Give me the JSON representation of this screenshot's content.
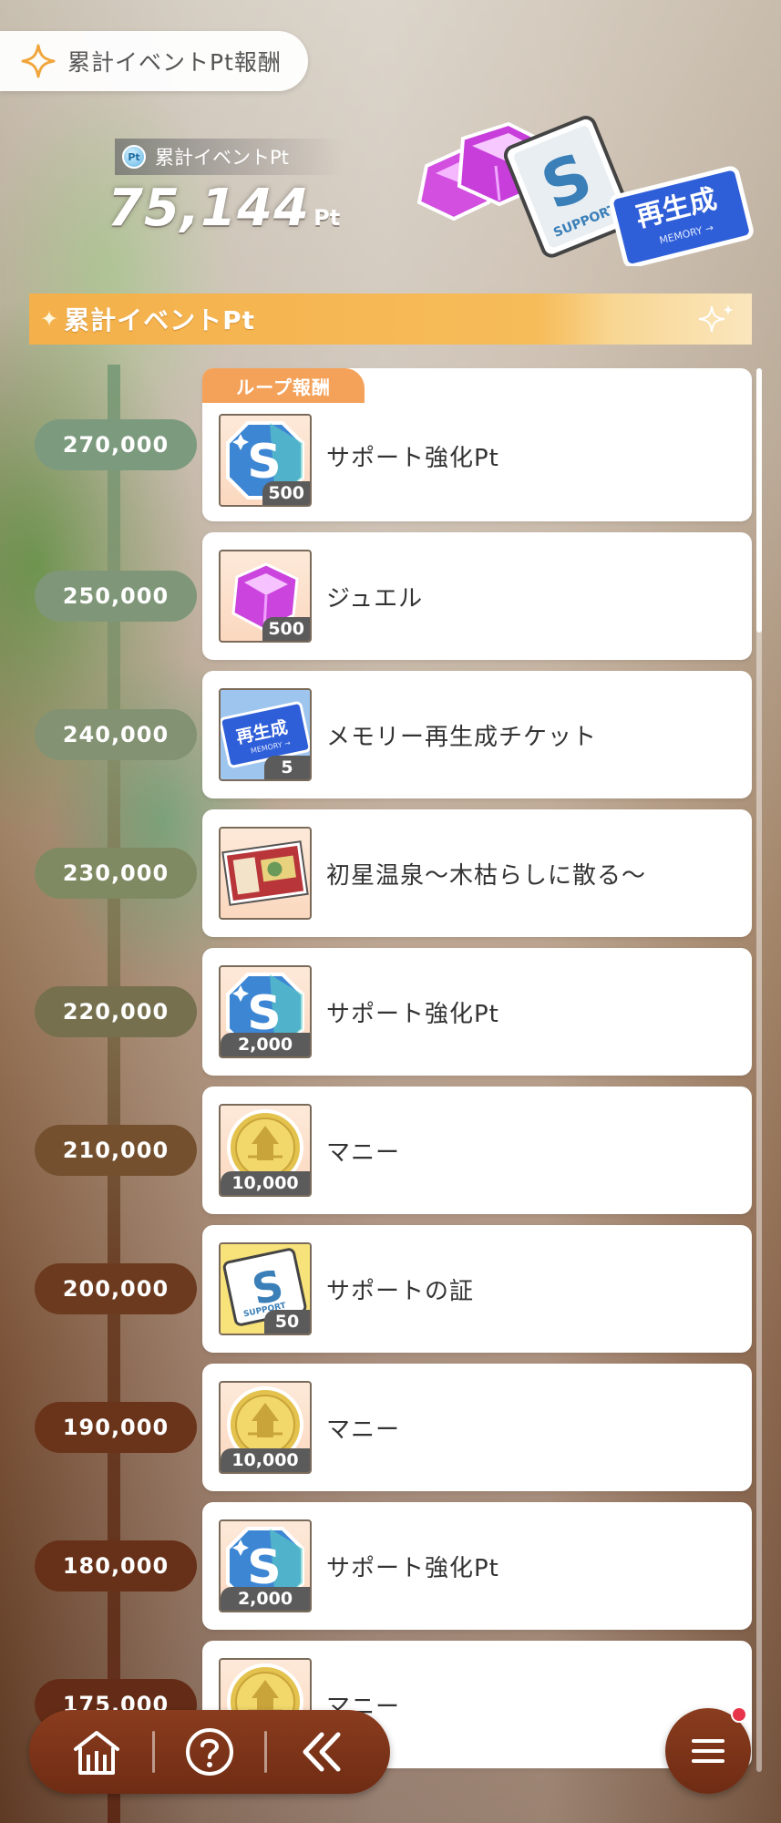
{
  "header": {
    "title": "累計イベントPt報酬",
    "points_label": "累計イベントPt",
    "points_badge": "Pt",
    "points_value": "75,144",
    "points_unit": "Pt"
  },
  "section": {
    "title": "累計イベントPt"
  },
  "loop_tag": "ループ報酬",
  "milestones": [
    {
      "threshold": "270,000",
      "color": "#7c9a7e",
      "item": "サポート強化Pt",
      "qty": "500",
      "icon": "support-pt-icon"
    },
    {
      "threshold": "250,000",
      "color": "#7f9778",
      "item": "ジュエル",
      "qty": "500",
      "icon": "jewel-icon"
    },
    {
      "threshold": "240,000",
      "color": "#829272",
      "item": "メモリー再生成チケット",
      "qty": "5",
      "icon": "memory-ticket-icon"
    },
    {
      "threshold": "230,000",
      "color": "#7f8a62",
      "item": "初星温泉～木枯らしに散る～",
      "qty": "",
      "icon": "memory-card-icon"
    },
    {
      "threshold": "220,000",
      "color": "#76704e",
      "item": "サポート強化Pt",
      "qty": "2,000",
      "icon": "support-pt-icon"
    },
    {
      "threshold": "210,000",
      "color": "#74502f",
      "item": "マニー",
      "qty": "10,000",
      "icon": "money-coin-icon"
    },
    {
      "threshold": "200,000",
      "color": "#6c3a1e",
      "item": "サポートの証",
      "qty": "50",
      "icon": "support-proof-icon"
    },
    {
      "threshold": "190,000",
      "color": "#6a341a",
      "item": "マニー",
      "qty": "10,000",
      "icon": "money-coin-icon"
    },
    {
      "threshold": "180,000",
      "color": "#673018",
      "item": "サポート強化Pt",
      "qty": "2,000",
      "icon": "support-pt-icon"
    },
    {
      "threshold": "175,000",
      "color": "#642c16",
      "item": "マニー",
      "qty": "",
      "icon": "money-coin-icon"
    }
  ],
  "colors": {
    "accent_orange": "#f4b04a",
    "loop_tag": "#f4a25a",
    "nav_brown": "#7a3418",
    "notification": "#e8344a"
  }
}
